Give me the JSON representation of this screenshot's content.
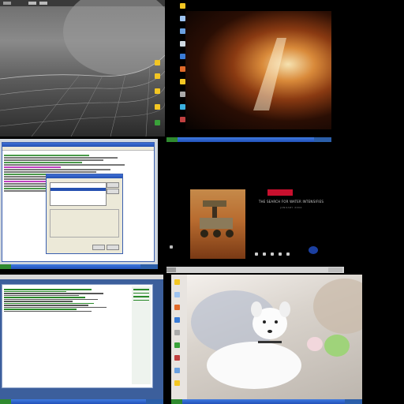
{
  "q1": {
    "name": "desktop-screenshot-1"
  },
  "q2": {
    "name": "desktop-screenshot-2"
  },
  "q3": {
    "name": "desktop-screenshot-3"
  },
  "q4": {
    "name": "desktop-screenshot-4",
    "banner_title": "THE SEARCH FOR WATER INTENSIFIES",
    "banner_sub": "JANUARY 2004"
  },
  "q5": {
    "name": "desktop-screenshot-5"
  },
  "q6": {
    "name": "desktop-screenshot-6"
  },
  "colors": {
    "xp_blue": "#2550b0",
    "xp_green": "#2f8a2f",
    "folder_yellow": "#f3c623",
    "nasa_red": "#c8102e"
  }
}
